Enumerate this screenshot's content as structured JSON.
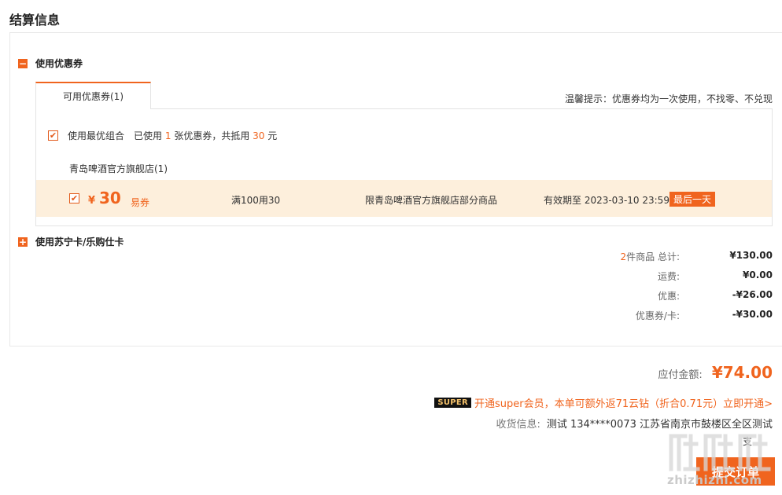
{
  "page": {
    "title": "结算信息"
  },
  "coupon_section": {
    "toggle_icon": "minus-square-icon",
    "title": "使用优惠券",
    "tab_label": "可用优惠券(1)",
    "tip": "温馨提示：优惠券均为一次使用，不找零、不兑现",
    "best_combo": {
      "checked": true,
      "label": "使用最优组合",
      "used_prefix": "已使用",
      "used_count": "1",
      "used_mid": "张优惠券，共抵用",
      "used_amount": "30",
      "used_suffix": "元"
    },
    "store": "青岛啤酒官方旗舰店(1)",
    "coupon": {
      "checked": true,
      "currency": "¥",
      "amount": "30",
      "type": "易券",
      "condition": "满100用30",
      "scope": "限青岛啤酒官方旗舰店部分商品",
      "validity": "有效期至 2023-03-10 23:59",
      "badge": "最后一天"
    }
  },
  "card_section": {
    "toggle_icon": "plus-square-icon",
    "title": "使用苏宁卡/乐购仕卡"
  },
  "summary": {
    "items_count": "2",
    "items_label": "件商品 总计:",
    "total": "¥130.00",
    "shipping_label": "运费:",
    "shipping": "¥0.00",
    "discount_label": "优惠:",
    "discount": "-¥26.00",
    "coupon_label": "优惠券/卡:",
    "coupon": "-¥30.00"
  },
  "payable": {
    "label": "应付金额:",
    "amount": "¥74.00"
  },
  "super_promo": {
    "badge": "SUPER",
    "text": "开通super会员，本单可额外返71云钻（折合0.71元）立即开通>"
  },
  "shipping_info": {
    "label": "收货信息:",
    "value": "测试 134****0073 江苏省南京市鼓楼区全区测试"
  },
  "footer": {
    "pay_label": "支",
    "submit": "提交订单"
  },
  "watermark": {
    "text": "zhizhizhi.com"
  },
  "colors": {
    "accent": "#f0641e",
    "coupon_bg": "#fdefdc"
  }
}
